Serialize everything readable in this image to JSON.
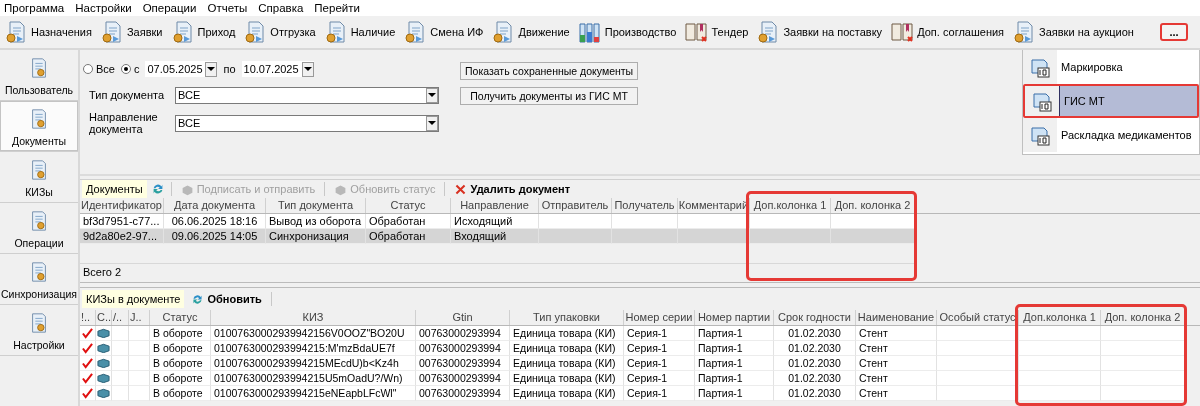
{
  "menu": [
    "Программа",
    "Настройки",
    "Операции",
    "Отчеты",
    "Справка",
    "Перейти"
  ],
  "toolbar": {
    "buttons": [
      {
        "label": "Назначения"
      },
      {
        "label": "Заявки"
      },
      {
        "label": "Приход"
      },
      {
        "label": "Отгрузка"
      },
      {
        "label": "Наличие"
      },
      {
        "label": "Смена ИФ"
      },
      {
        "label": "Движение"
      },
      {
        "label": "Производство"
      },
      {
        "label": "Тендер"
      },
      {
        "label": "Заявки на поставку"
      },
      {
        "label": "Доп. соглашения"
      },
      {
        "label": "Заявки на аукцион"
      }
    ],
    "more": {
      "label": "...",
      "highlighted": true
    }
  },
  "sidebar": {
    "items": [
      {
        "label": "Пользователь",
        "selected": false
      },
      {
        "label": "Документы",
        "selected": true
      },
      {
        "label": "КИЗы",
        "selected": false
      },
      {
        "label": "Операции",
        "selected": false
      },
      {
        "label": "Синхронизация",
        "selected": false
      },
      {
        "label": "Настройки",
        "selected": false
      }
    ]
  },
  "filter": {
    "period_options": [
      {
        "label": "Все",
        "selected": false
      },
      {
        "label": "с",
        "selected": true
      }
    ],
    "date_from": "07.05.2025",
    "to_label": "по",
    "date_to": "10.07.2025",
    "fields": [
      {
        "label": "Тип документа",
        "value": "ВСЕ"
      },
      {
        "label": "Направление документа",
        "value": "ВСЕ"
      }
    ],
    "buttons": [
      "Показать сохраненные документы",
      "Получить документы из ГИС МТ"
    ]
  },
  "side_panel": {
    "items": [
      {
        "label": "Маркировка",
        "selected": false,
        "highlighted": false
      },
      {
        "label": "ГИС МТ",
        "selected": true,
        "highlighted": true
      },
      {
        "label": "Раскладка медикаментов",
        "selected": false,
        "highlighted": false
      }
    ]
  },
  "documents": {
    "tab": "Документы",
    "actions": [
      {
        "label": "Подписать и отправить",
        "disabled": true
      },
      {
        "label": "Обновить статус",
        "disabled": true
      },
      {
        "label": "Удалить документ",
        "disabled": false
      }
    ],
    "columns": [
      {
        "label": "Идентификатор"
      },
      {
        "label": "Дата документа"
      },
      {
        "label": "Тип документа"
      },
      {
        "label": "Статус"
      },
      {
        "label": "Направление"
      },
      {
        "label": "Отправитель"
      },
      {
        "label": "Получатель"
      },
      {
        "label": "Комментарий"
      },
      {
        "label": "Доп.колонка 1",
        "highlighted": true
      },
      {
        "label": "Доп. колонка 2",
        "highlighted": true
      }
    ],
    "rows": [
      {
        "selected": false,
        "cells": [
          "bf3d7951-c77...",
          "06.06.2025 18:16",
          "Вывод из оборота",
          "Обработан",
          "Исходящий"
        ]
      },
      {
        "selected": true,
        "cells": [
          "9d2a80e2-97...",
          "09.06.2025 14:05",
          "Синхронизация",
          "Обработан",
          "Входящий"
        ]
      }
    ],
    "total": "Всего 2"
  },
  "kiz": {
    "tab": "КИЗы в документе",
    "refresh": "Обновить",
    "columns": [
      {
        "label": "!.."
      },
      {
        "label": "С.."
      },
      {
        "label": "/.."
      },
      {
        "label": "J.."
      },
      {
        "label": "Статус"
      },
      {
        "label": "КИЗ"
      },
      {
        "label": "Gtin"
      },
      {
        "label": "Тип упаковки"
      },
      {
        "label": "Номер серии"
      },
      {
        "label": "Номер партии"
      },
      {
        "label": "Срок годности"
      },
      {
        "label": "Наименование"
      },
      {
        "label": "Особый статус"
      },
      {
        "label": "Доп.колонка 1",
        "highlighted": true
      },
      {
        "label": "Доп. колонка 2",
        "highlighted": true
      }
    ],
    "rows": [
      {
        "checked": true,
        "cells": [
          "",
          "",
          "",
          "",
          "В обороте",
          "01007630002939942156V0OOZ\"BO20U",
          "00763000293994",
          "Единица товара (КИ)",
          "Серия-1",
          "Партия-1",
          "01.02.2030",
          "Стент"
        ]
      },
      {
        "checked": true,
        "cells": [
          "",
          "",
          "",
          "",
          "В обороте",
          "0100763000293994215:M'mzBdaUE7f",
          "00763000293994",
          "Единица товара (КИ)",
          "Серия-1",
          "Партия-1",
          "01.02.2030",
          "Стент"
        ]
      },
      {
        "checked": true,
        "cells": [
          "",
          "",
          "",
          "",
          "В обороте",
          "0100763000293994215MEcdU)b<Kz4h",
          "00763000293994",
          "Единица товара (КИ)",
          "Серия-1",
          "Партия-1",
          "01.02.2030",
          "Стент"
        ]
      },
      {
        "checked": true,
        "cells": [
          "",
          "",
          "",
          "",
          "В обороте",
          "0100763000293994215U5mOadU?/Wn)",
          "00763000293994",
          "Единица товара (КИ)",
          "Серия-1",
          "Партия-1",
          "01.02.2030",
          "Стент"
        ]
      },
      {
        "checked": true,
        "cells": [
          "",
          "",
          "",
          "",
          "В обороте",
          "0100763000293994215eNEapbLFcWl\"",
          "00763000293994",
          "Единица товара (КИ)",
          "Серия-1",
          "Партия-1",
          "01.02.2030",
          "Стент"
        ]
      }
    ]
  }
}
